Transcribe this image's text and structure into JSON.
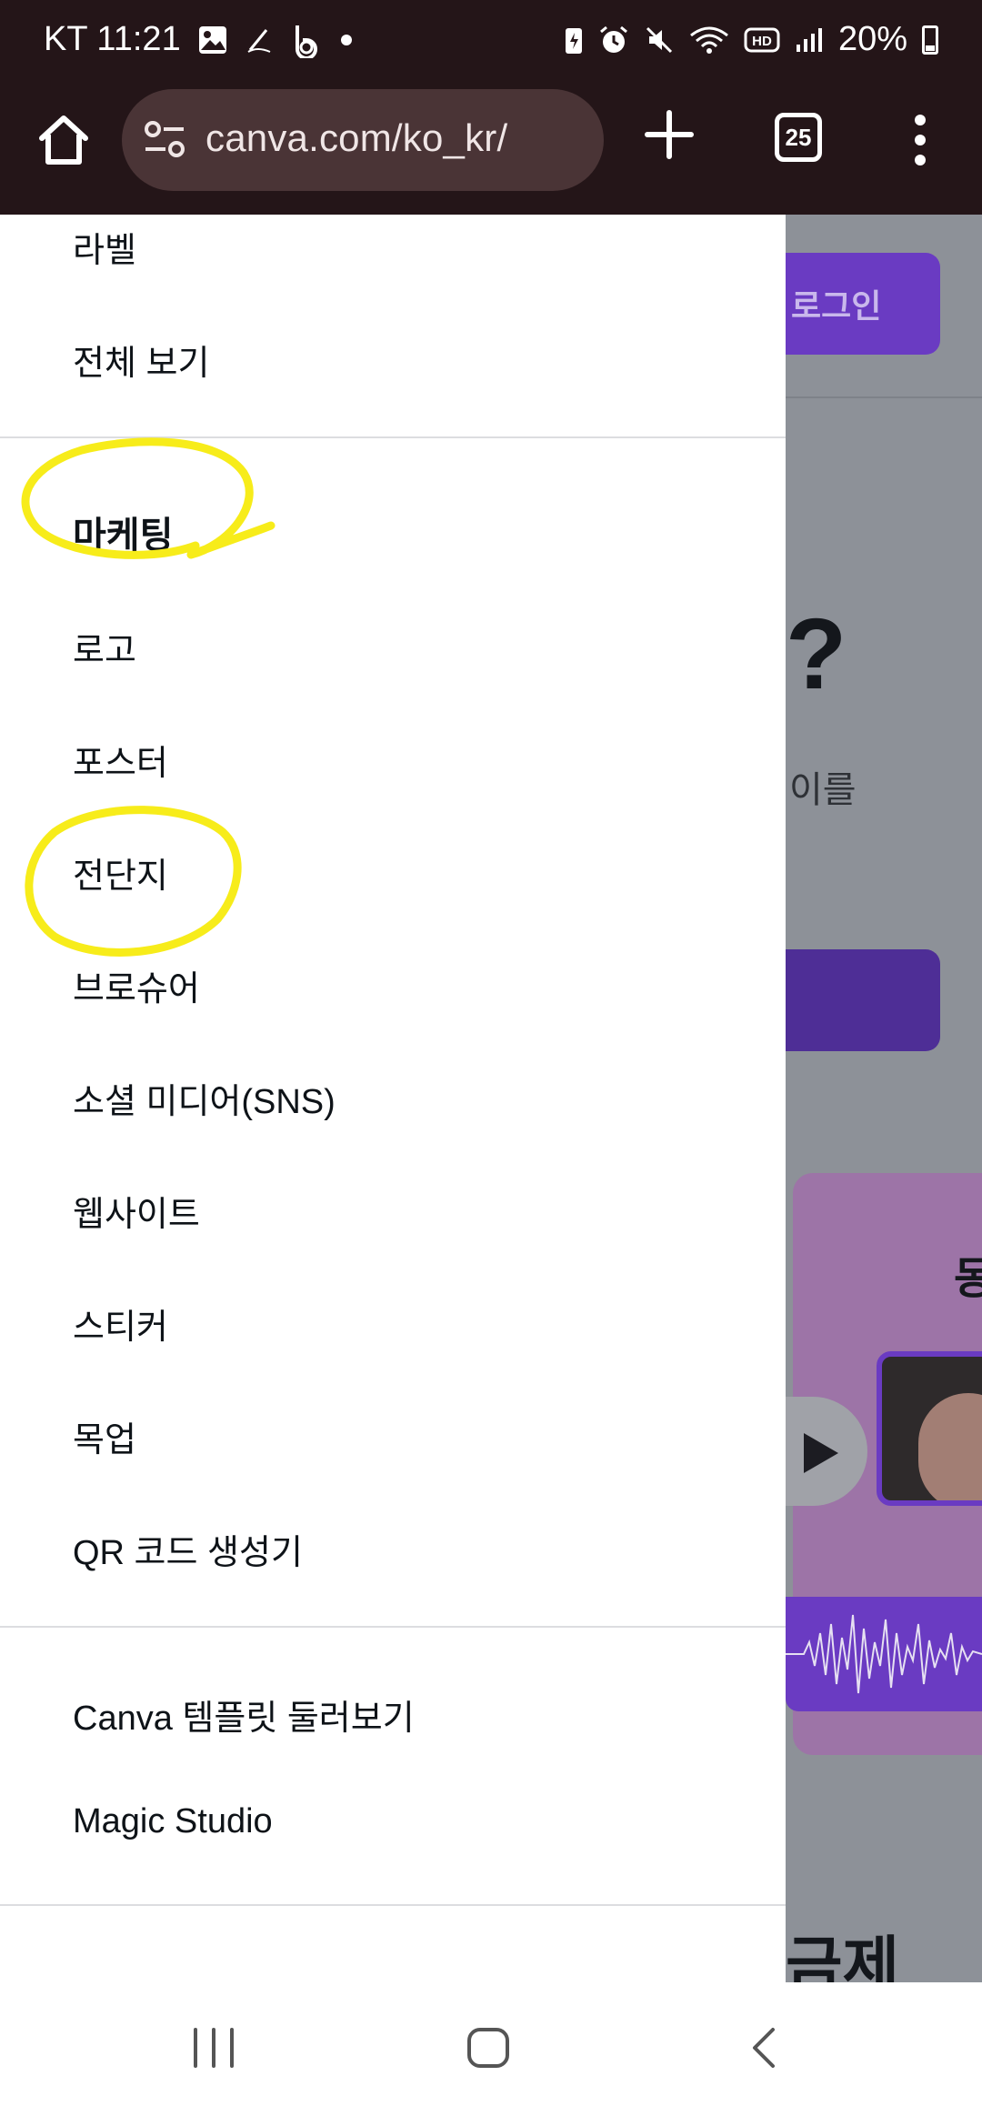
{
  "status_bar": {
    "carrier_time": "KT 11:21",
    "battery": "20%",
    "left_icons": [
      "gallery-icon",
      "signature-icon",
      "b-app-icon",
      "notification-dot-icon"
    ],
    "right_icons": [
      "battery-saver-icon",
      "alarm-icon",
      "mute-icon",
      "wifi-icon",
      "hd-icon",
      "signal-icon",
      "battery-icon"
    ]
  },
  "browser": {
    "url": "canva.com/ko_kr/",
    "tab_count": "25"
  },
  "drawer": {
    "items_top": [
      {
        "label": "라벨"
      },
      {
        "label": "전체 보기"
      }
    ],
    "marketing": {
      "heading": "마케팅",
      "items": [
        {
          "label": "로고"
        },
        {
          "label": "포스터"
        },
        {
          "label": "전단지"
        },
        {
          "label": "브로슈어"
        },
        {
          "label": "소셜 미디어(SNS)"
        },
        {
          "label": "웹사이트"
        },
        {
          "label": "스티커"
        },
        {
          "label": "목업"
        },
        {
          "label": "QR 코드 생성기"
        }
      ]
    },
    "bottom_items": [
      {
        "label": "Canva 템플릿 둘러보기"
      },
      {
        "label": "Magic Studio"
      }
    ]
  },
  "background_page": {
    "login_label": "로그인",
    "question_mark": "?",
    "text_fragment": "이를",
    "card_title_fragment": "동",
    "footer_fragment": "금제"
  },
  "colors": {
    "chrome_bg": "#241518",
    "url_bar_bg": "#4a3436",
    "brand_purple": "#6a3bc2",
    "annotation_yellow": "#f7ec1a"
  }
}
